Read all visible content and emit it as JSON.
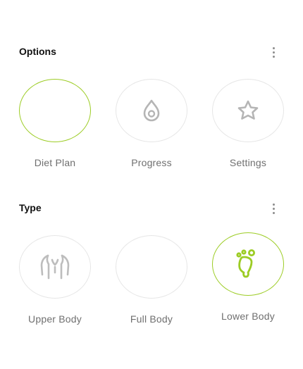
{
  "sections": [
    {
      "title": "Options",
      "items": [
        {
          "label": "Diet Plan",
          "icon": "none",
          "selected": true
        },
        {
          "label": "Progress",
          "icon": "water-drop-icon",
          "selected": false
        },
        {
          "label": "Settings",
          "icon": "star-icon",
          "selected": false
        }
      ]
    },
    {
      "title": "Type",
      "items": [
        {
          "label": "Upper Body",
          "icon": "upper-body-icon",
          "selected": false
        },
        {
          "label": "Full Body",
          "icon": "none",
          "selected": false
        },
        {
          "label": "Lower Body",
          "icon": "footprint-icon",
          "selected": true
        }
      ]
    }
  ],
  "colors": {
    "accent": "#9ccc24",
    "circle_border": "#e6e6e6",
    "icon_gray": "#b5b5b5",
    "label_gray": "#6f6f6f"
  }
}
